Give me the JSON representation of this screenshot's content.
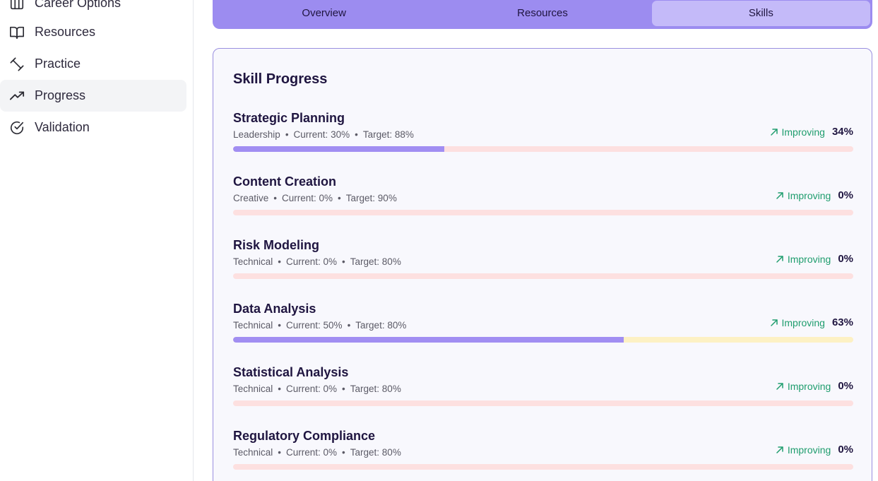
{
  "sidebar": {
    "items": [
      {
        "label": "Career Options",
        "icon": "columns-icon",
        "active": false
      },
      {
        "label": "Resources",
        "icon": "book-icon",
        "active": false
      },
      {
        "label": "Practice",
        "icon": "dumbbell-icon",
        "active": false
      },
      {
        "label": "Progress",
        "icon": "trending-up-icon",
        "active": true
      },
      {
        "label": "Validation",
        "icon": "check-circle-icon",
        "active": false
      }
    ]
  },
  "tabs": [
    {
      "label": "Overview",
      "active": false
    },
    {
      "label": "Resources",
      "active": false
    },
    {
      "label": "Skills",
      "active": true
    }
  ],
  "card": {
    "title": "Skill Progress",
    "skills": [
      {
        "name": "Strategic Planning",
        "category": "Leadership",
        "current": "Current: 30%",
        "target": "Target: 88%",
        "status": "Improving",
        "progress": "34%",
        "progress_value": 0.34,
        "track_color": "#fde0e0"
      },
      {
        "name": "Content Creation",
        "category": "Creative",
        "current": "Current: 0%",
        "target": "Target: 90%",
        "status": "Improving",
        "progress": "0%",
        "progress_value": 0,
        "track_color": "#fde0e0"
      },
      {
        "name": "Risk Modeling",
        "category": "Technical",
        "current": "Current: 0%",
        "target": "Target: 80%",
        "status": "Improving",
        "progress": "0%",
        "progress_value": 0,
        "track_color": "#fde0e0"
      },
      {
        "name": "Data Analysis",
        "category": "Technical",
        "current": "Current: 50%",
        "target": "Target: 80%",
        "status": "Improving",
        "progress": "63%",
        "progress_value": 0.63,
        "track_color": "#fdf1c4"
      },
      {
        "name": "Statistical Analysis",
        "category": "Technical",
        "current": "Current: 0%",
        "target": "Target: 80%",
        "status": "Improving",
        "progress": "0%",
        "progress_value": 0,
        "track_color": "#fde0e0"
      },
      {
        "name": "Regulatory Compliance",
        "category": "Technical",
        "current": "Current: 0%",
        "target": "Target: 80%",
        "status": "Improving",
        "progress": "0%",
        "progress_value": 0,
        "track_color": "#fde0e0"
      }
    ]
  },
  "colors": {
    "accent": "#9c8cf0",
    "progress_fill": "#a18ef2",
    "improving": "#1f9d6e"
  }
}
